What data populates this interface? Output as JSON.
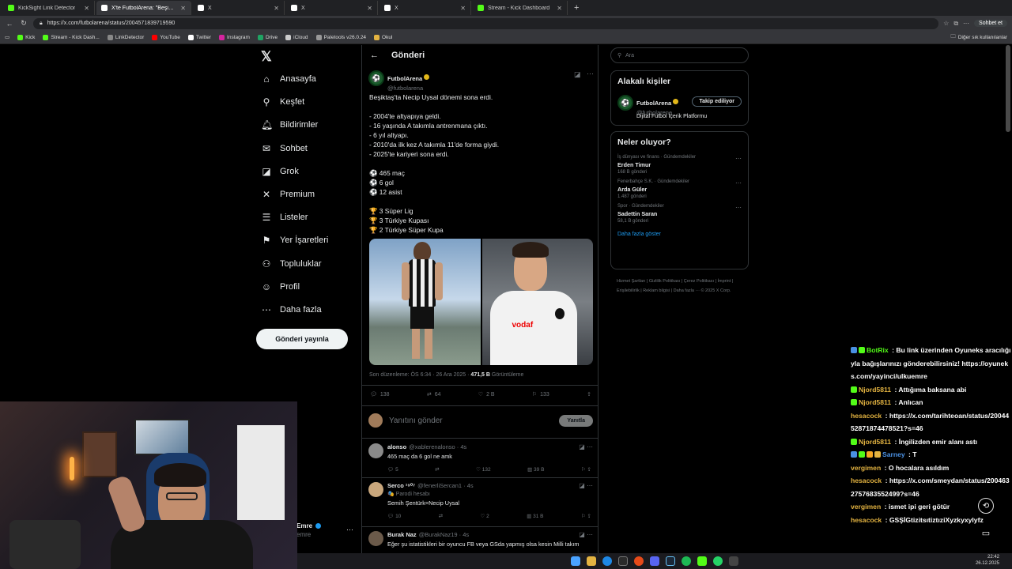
{
  "browser": {
    "tabs": [
      {
        "label": "KickSight Link Detector",
        "color": "#53fc18"
      },
      {
        "label": "X'te FutbolArena: \"Beşiktaş'ta Nec",
        "color": "#ffffff"
      },
      {
        "label": "X",
        "color": "#ffffff"
      },
      {
        "label": "X",
        "color": "#ffffff"
      },
      {
        "label": "X",
        "color": "#ffffff"
      },
      {
        "label": "Stream - Kick Dashboard",
        "color": "#53fc18"
      }
    ],
    "url": "https://x.com/futbolarena/status/2004571839719590",
    "chat_button": "Sohbet et",
    "bookmarks": [
      {
        "label": "Kick",
        "color": "#53fc18"
      },
      {
        "label": "Stream - Kick Dash...",
        "color": "#53fc18"
      },
      {
        "label": "LinkDetector",
        "color": "#888888"
      },
      {
        "label": "YouTube",
        "color": "#ff0000"
      },
      {
        "label": "Twitter",
        "color": "#ffffff"
      },
      {
        "label": "Instagram",
        "color": "#d6249f"
      },
      {
        "label": "Drive",
        "color": "#1fa463"
      },
      {
        "label": "iCloud",
        "color": "#cccccc"
      },
      {
        "label": "Paletools v26.0.24",
        "color": "#999999"
      },
      {
        "label": "Okul",
        "color": "#e3b341"
      }
    ],
    "other_bookmarks": "Diğer sık kullanılanlar"
  },
  "nav": {
    "items": [
      {
        "label": "Anasayfa",
        "icon": "⌂"
      },
      {
        "label": "Keşfet",
        "icon": "⚲"
      },
      {
        "label": "Bildirimler",
        "icon": "🔔︎"
      },
      {
        "label": "Sohbet",
        "icon": "✉"
      },
      {
        "label": "Grok",
        "icon": "◪"
      },
      {
        "label": "Premium",
        "icon": "✕"
      },
      {
        "label": "Listeler",
        "icon": "☰"
      },
      {
        "label": "Yer İşaretleri",
        "icon": "⚑"
      },
      {
        "label": "Topluluklar",
        "icon": "⚇"
      },
      {
        "label": "Profil",
        "icon": "☺"
      },
      {
        "label": "Daha fazla",
        "icon": "⋯"
      }
    ],
    "post_button": "Gönderi yayınla",
    "account_name": "Emre",
    "account_handle": "emre"
  },
  "post": {
    "header": "Gönderi",
    "author_name": "FutbolArena",
    "author_handle": "@futbolarena",
    "text": "Beşiktaş'ta Necip Uysal dönemi sona erdi.\n\n- 2004'te altyapıya geldi.\n- 16 yaşında A takımla antrenmana çıktı.\n- 6 yıl altyapı.\n- 2010'da ilk kez A takımla 11'de forma giydi.\n- 2025'te kariyeri sona erdi.\n\n⚽ 465 maç\n⚽ 6 gol\n⚽ 12 asist\n\n🏆 3 Süper Lig\n🏆 3 Türkiye Kupası\n🏆 2 Türkiye Süper Kupa",
    "meta_prefix": "Son düzenleme: ÖS 6:34 · 26 Ara 2025 · ",
    "views": "471,5 B",
    "views_label": " Görüntüleme",
    "stats": {
      "replies": "138",
      "reposts": "64",
      "likes": "2 B",
      "bookmarks": "133"
    },
    "reply_placeholder": "Yanıtını gönder",
    "reply_button": "Yanıtla"
  },
  "replies": [
    {
      "name": "alonso",
      "handle": "@xablerenalonso · 4s",
      "text": "465 maç da 6 gol ne amk",
      "sub": "",
      "stats": [
        "5",
        "",
        "132",
        "39 B"
      ],
      "avatar": "#8a8a8a"
    },
    {
      "name": "Serco ¹⁹⁰⁷",
      "handle": "@fenerliSercan1 · 4s",
      "sub": "🎭 Parodi hesabı",
      "text": "Semih Şentürk=Necip Uysal",
      "stats": [
        "10",
        "",
        "2",
        "31 B"
      ],
      "avatar": "#c9a77c"
    },
    {
      "name": "Burak Naz",
      "handle": "@BurakNaz19 · 4s",
      "sub": "",
      "text": "Eğer şu istatistikleri bir oyuncu FB veya GSda yapmış olsa kesin Milli takım",
      "stats": [
        "",
        "",
        "",
        ""
      ],
      "avatar": "#6b5a4a"
    }
  ],
  "right": {
    "search_placeholder": "Ara",
    "related_title": "Alakalı kişiler",
    "related_name": "FutbolArena",
    "related_handle": "@futbolarena",
    "related_bio": "Dijital Futbol İçerik Platformu",
    "follow_button": "Takip ediliyor",
    "trends_title": "Neler oluyor?",
    "trends": [
      {
        "category": "İş dünyası ve finans · Gündemdekiler",
        "name": "Erden Timur",
        "count": "168 B gönderi"
      },
      {
        "category": "Fenerbahçe S.K. · Gündemdekiler",
        "name": "Arda Güler",
        "count": "1.487 gönderi"
      },
      {
        "category": "Spor · Gündemdekiler",
        "name": "Sadettin Saran",
        "count": "58,1 B gönderi"
      }
    ],
    "show_more": "Daha fazla göster",
    "footer": "Hizmet Şartları | Gizlilik Politikası | Çerez Politikası | İmprint | Erişilebilirlik | Reklam bilgisi | Daha fazla ··· © 2025 X Corp."
  },
  "chat": [
    {
      "name": "BotRix",
      "msg": " : Bu link üzerinden Oyuneks aracılığıyla bağışlarınızı gönderebilirsiniz! https://oyuneks.com/yayinci/ulkuemre",
      "color": "#53fc18",
      "badges": [
        "#4a90e2",
        "#53fc18"
      ]
    },
    {
      "name": "Njord5811",
      "msg": " : Attığıma baksana abi",
      "color": "#e3b341",
      "badges": [
        "#53fc18"
      ]
    },
    {
      "name": "Njord5811",
      "msg": " : Anlıcan",
      "color": "#e3b341",
      "badges": [
        "#53fc18"
      ]
    },
    {
      "name": "hesacock",
      "msg": " : https://x.com/tarihteoan/status/2004452871874478521?s=46",
      "color": "#e3b341",
      "badges": []
    },
    {
      "name": "Njord5811",
      "msg": " : İngilizden emir alanı astı",
      "color": "#e3b341",
      "badges": [
        "#53fc18"
      ]
    },
    {
      "name": "Sarney",
      "msg": " : T",
      "color": "#4a90e2",
      "badges": [
        "#4a90e2",
        "#53fc18",
        "#f5a623",
        "#e3b341"
      ]
    },
    {
      "name": "vergimen",
      "msg": " : O hocalara asıldım",
      "color": "#e3b341",
      "badges": []
    },
    {
      "name": "hesacock",
      "msg": " : https://x.com/smeydan/status/2004632757683552499?s=46",
      "color": "#e3b341",
      "badges": []
    },
    {
      "name": "vergimen",
      "msg": " : ismet ipi geri götür",
      "color": "#e3b341",
      "badges": []
    },
    {
      "name": "hesacock",
      "msg": " : GSŞİGtizitsıtiztıziXyzkyxylyfz",
      "color": "#e3b341",
      "badges": []
    }
  ],
  "taskbar": {
    "time": "22:42",
    "date": "26.12.2025"
  },
  "colors": {
    "accent": "#1d9bf0",
    "bg": "#000000",
    "border": "#2f3336",
    "muted": "#71767b"
  }
}
